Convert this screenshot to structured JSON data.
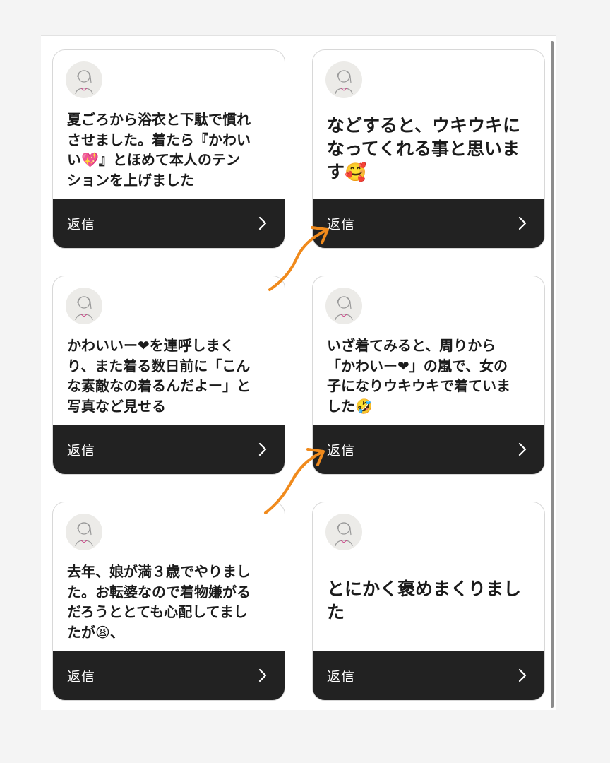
{
  "cards": [
    {
      "message": "夏ごろから浴衣と下駄で慣れ\nさせました。着たら『かわい\nい💖』とほめて本人のテン\nションを上げました",
      "reply_label": "返信"
    },
    {
      "message": "などすると、ウキウキに\nなってくれる事と思いま\nす🥰",
      "reply_label": "返信"
    },
    {
      "message": "かわいいー❤を連呼しまく\nり、また着る数日前に「こん\nな素敵なの着るんだよー」と\n写真など見せる",
      "reply_label": "返信"
    },
    {
      "message": "いざ着てみると、周りから\n「かわいー❤」の嵐で、女の\n子になりウキウキで着ていま\nした🤣",
      "reply_label": "返信"
    },
    {
      "message": "去年、娘が満３歳でやりまし\nた。お転婆なので着物嫌がる\nだろうととても心配してまし\nたが😫、",
      "reply_label": "返信"
    },
    {
      "message": "とにかく褒めまくりまし\nた",
      "reply_label": "返信"
    }
  ],
  "annotation_color": "#f08a1c",
  "icons": {
    "avatar": "girl-avatar-icon",
    "chevron": "chevron-right-icon"
  }
}
